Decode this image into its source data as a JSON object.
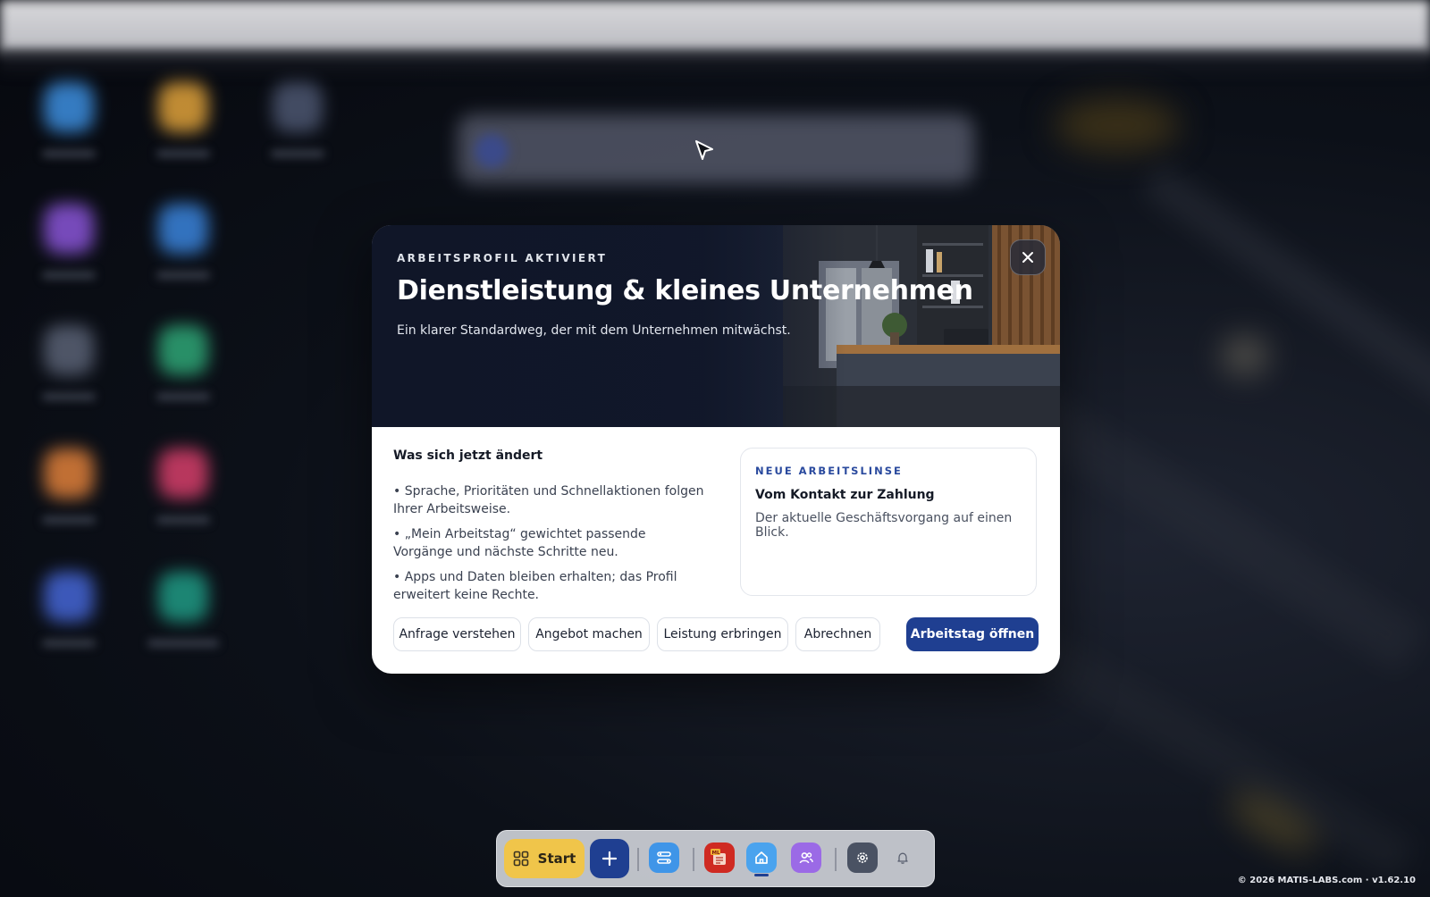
{
  "dialog": {
    "eyebrow": "ARBEITSPROFIL AKTIVIERT",
    "title": "Dienstleistung & kleines Unternehmen",
    "subtitle": "Ein klarer Standardweg, der mit dem Unternehmen mitwächst.",
    "close_icon": "close-icon",
    "changes": {
      "title": "Was sich jetzt ändert",
      "items": [
        "• Sprache, Prioritäten und Schnellaktionen folgen Ihrer Arbeitsweise.",
        "• „Mein Arbeitstag“ gewichtet passende Vorgänge und nächste Schritte neu.",
        "• Apps und Daten bleiben erhalten; das Profil erweitert keine Rechte."
      ]
    },
    "lens": {
      "eyebrow": "NEUE ARBEITSLINSE",
      "title": "Vom Kontakt zur Zahlung",
      "text": "Der aktuelle Geschäftsvorgang auf einen Blick."
    },
    "steps": [
      "Anfrage verstehen",
      "Angebot machen",
      "Leistung erbringen",
      "Abrechnen"
    ],
    "primary_label": "Arbeitstag öffnen"
  },
  "dock": {
    "start_label": "Start",
    "icons": [
      "grid-icon",
      "plus-icon",
      "workflow-icon",
      "ml-app-icon",
      "home-icon",
      "people-icon",
      "settings-icon",
      "bell-icon"
    ]
  },
  "footer": "© 2026 MATIS-LABS.com · v1.62.10",
  "colors": {
    "primary": "#1f3f91",
    "accent_yellow": "#f0c54a",
    "eyebrow_blue": "#2a4a9e"
  }
}
